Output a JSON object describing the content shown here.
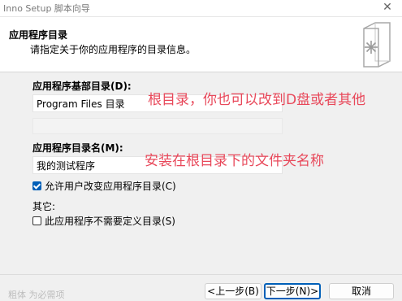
{
  "window": {
    "title": "Inno Setup 脚本向导",
    "close_glyph": "✕"
  },
  "header": {
    "title": "应用程序目录",
    "subtitle": "请指定关于你的应用程序的目录信息。"
  },
  "base_folder": {
    "label": "应用程序基部目录(D):",
    "value": "Program Files 目录"
  },
  "folder_name": {
    "label": "应用程序目录名(M):",
    "value": "我的测试程序"
  },
  "allow_change": {
    "label": "允许用户改变应用程序目录(C)",
    "checked": true
  },
  "other": {
    "label": "其它:",
    "no_folder": {
      "label": "此应用程序不需要定义目录(S)",
      "checked": false
    }
  },
  "annotations": {
    "root_dir_note": "根目录，你也可以改到D盘或者其他",
    "folder_name_note": "安装在根目录下的文件夹名称"
  },
  "footer": {
    "note": "粗体 为必需项",
    "back_label": "<上一步(B)",
    "next_label": "下一步(N)>",
    "cancel_label": "取消"
  },
  "colors": {
    "accent": "#005fb8",
    "annotation": "#e8485a"
  },
  "icons": [
    "close-icon",
    "wizard-icon",
    "checkbox-icon"
  ]
}
